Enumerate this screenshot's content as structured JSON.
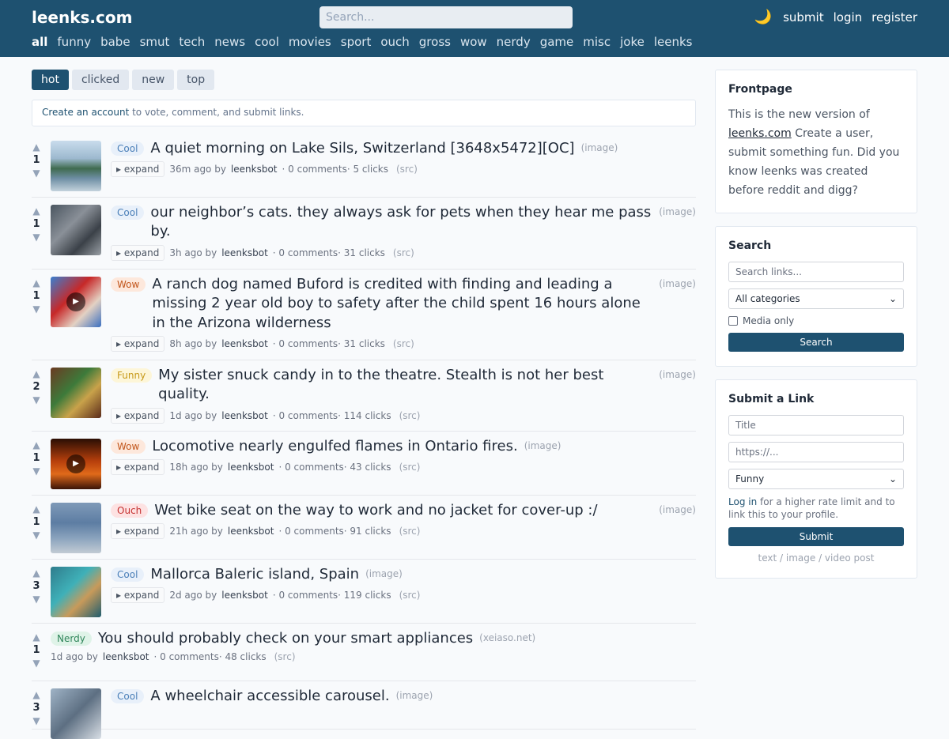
{
  "header": {
    "logo": "leenks.com",
    "search_placeholder": "Search...",
    "moon": "🌙",
    "links": [
      "submit",
      "login",
      "register"
    ],
    "nav": [
      "all",
      "funny",
      "babe",
      "smut",
      "tech",
      "news",
      "cool",
      "movies",
      "sport",
      "ouch",
      "gross",
      "wow",
      "nerdy",
      "game",
      "misc",
      "joke",
      "leenks"
    ]
  },
  "tabs": [
    "hot",
    "clicked",
    "new",
    "top"
  ],
  "notice": {
    "link": "Create an account",
    "rest": " to vote, comment, and submit links."
  },
  "vote_up": "▲",
  "vote_down": "▼",
  "expand_label": "▸ expand",
  "posts": [
    {
      "score": "1",
      "badge": "Cool",
      "title": "A quiet morning on Lake Sils, Switzerland [3648x5472][OC]",
      "domain": "(image)",
      "age": "36m ago by",
      "user": "leenksbot",
      "stats": "· 0 comments· 5 clicks",
      "src": "(src)",
      "play": false
    },
    {
      "score": "1",
      "badge": "Cool",
      "title": "our neighbor’s cats. they always ask for pets when they hear me pass by.",
      "domain": "(image)",
      "age": "3h ago by",
      "user": "leenksbot",
      "stats": "· 0 comments· 31 clicks",
      "src": "(src)",
      "play": false
    },
    {
      "score": "1",
      "badge": "Wow",
      "title": "A ranch dog named Buford is credited with finding and leading a missing 2 year old boy to safety after the child spent 16 hours alone in the Arizona wilderness",
      "domain": "(image)",
      "age": "8h ago by",
      "user": "leenksbot",
      "stats": "· 0 comments· 31 clicks",
      "src": "(src)",
      "play": true
    },
    {
      "score": "2",
      "badge": "Funny",
      "title": "My sister snuck candy in to the theatre. Stealth is not her best quality.",
      "domain": "(image)",
      "age": "1d ago by",
      "user": "leenksbot",
      "stats": "· 0 comments· 114 clicks",
      "src": "(src)",
      "play": false
    },
    {
      "score": "1",
      "badge": "Wow",
      "title": "Locomotive nearly engulfed flames in Ontario fires.",
      "domain": "(image)",
      "age": "18h ago by",
      "user": "leenksbot",
      "stats": "· 0 comments· 43 clicks",
      "src": "(src)",
      "play": true
    },
    {
      "score": "1",
      "badge": "Ouch",
      "title": "Wet bike seat on the way to work and no jacket for cover-up :/",
      "domain": "(image)",
      "age": "21h ago by",
      "user": "leenksbot",
      "stats": "· 0 comments· 91 clicks",
      "src": "(src)",
      "play": false
    },
    {
      "score": "3",
      "badge": "Cool",
      "title": "Mallorca Baleric island, Spain",
      "domain": "(image)",
      "age": "2d ago by",
      "user": "leenksbot",
      "stats": "· 0 comments· 119 clicks",
      "src": "(src)",
      "play": false
    },
    {
      "score": "1",
      "badge": "Nerdy",
      "title": "You should probably check on your smart appliances",
      "domain": "(xeiaso.net)",
      "age": "1d ago by",
      "user": "leenksbot",
      "stats": "· 0 comments· 48 clicks",
      "src": "(src)",
      "play": false
    },
    {
      "score": "3",
      "badge": "Cool",
      "title": "A wheelchair accessible carousel.",
      "domain": "(image)",
      "age": "",
      "user": "",
      "stats": "",
      "src": "",
      "play": false
    }
  ],
  "sidebar": {
    "frontpage": {
      "title": "Frontpage",
      "text1": "This is the new version of ",
      "link": "leenks.com",
      "text2": " Create a user, submit something fun. Did you know leenks was created before reddit and digg?"
    },
    "search": {
      "title": "Search",
      "placeholder": "Search links...",
      "category": "All categories",
      "media_only": "Media only",
      "button": "Search"
    },
    "submit": {
      "title": "Submit a Link",
      "title_placeholder": "Title",
      "url_placeholder": "https://...",
      "category": "Funny",
      "login_link": "Log in",
      "login_rest": " for a higher rate limit and to link this to your profile.",
      "button": "Submit",
      "footer": "text / image / video post"
    }
  },
  "colors": {
    "header_bg": "#1e5170",
    "accent": "#1e5170"
  }
}
